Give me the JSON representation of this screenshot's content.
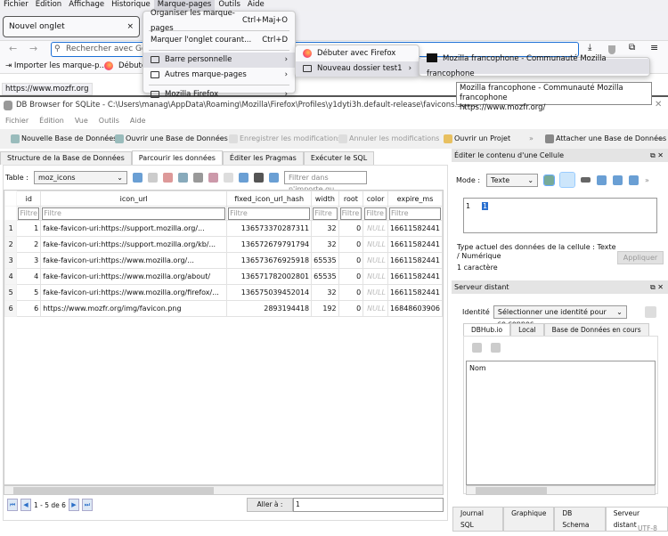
{
  "firefox": {
    "menubar": [
      "Fichier",
      "Edition",
      "Affichage",
      "Historique",
      "Marque-pages",
      "Outils",
      "Aide"
    ],
    "tab_title": "Nouvel onglet",
    "tab_close": "×",
    "url_placeholder": "Rechercher avec Go",
    "bookmarks": [
      "Importer les marque-p...",
      "Débuter"
    ],
    "status_url": "https://www.mozfr.org",
    "bookmarks_menu": {
      "organize": "Organiser les marque-pages",
      "organize_shortcut": "Ctrl+Maj+O",
      "bookmark_tab": "Marquer l'onglet courant...",
      "bookmark_tab_shortcut": "Ctrl+D",
      "toolbar": "Barre personnelle",
      "other": "Autres marque-pages",
      "mozilla": "Mozilla Firefox"
    },
    "submenu": {
      "getting_started": "Débuter avec Firefox",
      "folder": "Nouveau dossier test1"
    },
    "subsubmenu": {
      "item": "Mozilla francophone - Communauté Mozilla francophone"
    },
    "tooltip": {
      "title": "Mozilla francophone - Communauté Mozilla francophone",
      "url": "https://www.mozfr.org/"
    }
  },
  "db": {
    "title": "DB Browser for SQLite - C:\\Users\\manag\\AppData\\Roaming\\Mozilla\\Firefox\\Profiles\\y1dyti3h.default-release\\favicons.sqlite",
    "menu": [
      "Fichier",
      "Édition",
      "Vue",
      "Outils",
      "Aide"
    ],
    "toolbar": {
      "new_db": "Nouvelle Base de Données",
      "open_db": "Ouvrir une Base de Données",
      "save": "Enregistrer les modifications",
      "revert": "Annuler les modifications",
      "open_project": "Ouvrir un Projet",
      "attach": "Attacher une Base de Données",
      "more": "»"
    },
    "tabs": [
      "Structure de la Base de Données",
      "Parcourir les données",
      "Éditer les Pragmas",
      "Exécuter le SQL"
    ],
    "table_label": "Table :",
    "table_value": "moz_icons",
    "filter_placeholder": "Filtrer dans n'importe qu...",
    "columns": [
      "id",
      "icon_url",
      "fixed_icon_url_hash",
      "width",
      "root",
      "color",
      "expire_ms"
    ],
    "filter_text": "Filtre",
    "rows": [
      [
        "1",
        "1",
        "fake-favicon-uri:https://support.mozilla.org/...",
        "136573370287311",
        "32",
        "0",
        "NULL",
        "16611582441"
      ],
      [
        "2",
        "2",
        "fake-favicon-uri:https://support.mozilla.org/kb/...",
        "136572679791794",
        "32",
        "0",
        "NULL",
        "16611582441"
      ],
      [
        "3",
        "3",
        "fake-favicon-uri:https://www.mozilla.org/...",
        "136573676925918",
        "65535",
        "0",
        "NULL",
        "16611582441"
      ],
      [
        "4",
        "4",
        "fake-favicon-uri:https://www.mozilla.org/about/",
        "136571782002801",
        "65535",
        "0",
        "NULL",
        "16611582441"
      ],
      [
        "5",
        "5",
        "fake-favicon-uri:https://www.mozilla.org/firefox/...",
        "136575039452014",
        "32",
        "0",
        "NULL",
        "16611582441"
      ],
      [
        "6",
        "6",
        "https://www.mozfr.org/img/favicon.png",
        "2893194418",
        "192",
        "0",
        "NULL",
        "16848603906"
      ]
    ],
    "pager": "1 - 5 de 6",
    "goto_label": "Aller à :",
    "goto_value": "1",
    "edit_cell": {
      "title": "Éditer le contenu d'une Cellule",
      "mode_label": "Mode :",
      "mode_value": "Texte",
      "line_no": "1",
      "value": "1",
      "type_text": "Type actuel des données de la cellule : Texte / Numérique",
      "chars": "1 caractère",
      "apply": "Appliquer"
    },
    "remote": {
      "title": "Serveur distant",
      "identity_label": "Identité",
      "identity_value": "Sélectionner une identité pour se connec",
      "tabs": [
        "DBHub.io",
        "Local",
        "Base de Données en cours"
      ],
      "column": "Nom"
    },
    "bottom_tabs": [
      "Journal SQL",
      "Graphique",
      "DB Schema",
      "Serveur distant"
    ],
    "encoding": "UTF-8"
  }
}
